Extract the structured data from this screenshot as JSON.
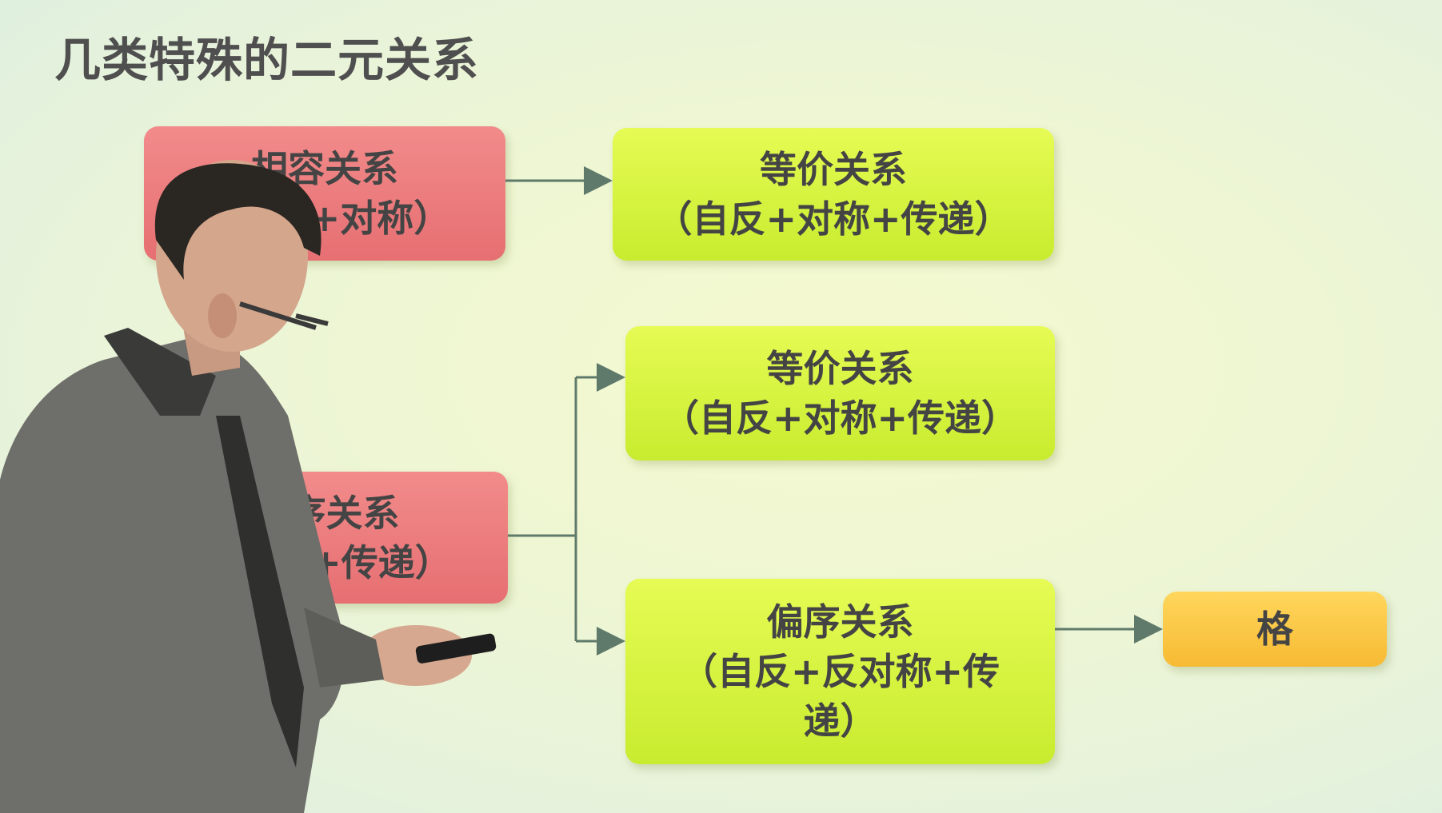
{
  "title": "几类特殊的二元关系",
  "boxes": {
    "compat": {
      "name": "相容关系",
      "props": "（自反+对称）"
    },
    "equiv_top": {
      "name": "等价关系",
      "props": "（自反+对称+传递）"
    },
    "preorder": {
      "name": "拟序关系",
      "props": "（自反+传递）"
    },
    "equiv_mid": {
      "name": "等价关系",
      "props": "（自反+对称+传递）"
    },
    "partial": {
      "name": "偏序关系",
      "props_line1": "（自反+反对称+传",
      "props_line2": "递）"
    },
    "lattice": {
      "name": "格"
    }
  },
  "colors": {
    "red_box": "#ec7b7e",
    "green_box": "#d7f43e",
    "yellow_box": "#f9c846",
    "arrow": "#5f7a6a"
  }
}
